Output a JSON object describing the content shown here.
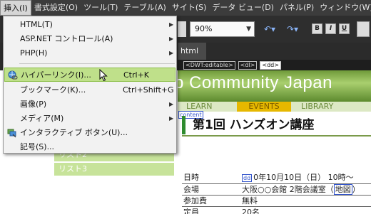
{
  "menubar": [
    {
      "label": "挿入(I)",
      "active": true
    },
    {
      "label": "書式設定(O)"
    },
    {
      "label": "ツール(T)"
    },
    {
      "label": "テーブル(A)"
    },
    {
      "label": "サイト(S)"
    },
    {
      "label": "データ ビュー(D)"
    },
    {
      "label": "パネル(P)"
    },
    {
      "label": "ウィンドウ(W)"
    }
  ],
  "toolbar": {
    "zoom": "90%",
    "bold": "B",
    "italic": "I",
    "underline": "U"
  },
  "tab": {
    "label": "html"
  },
  "tagbar": [
    "<DWT:editable>",
    "<dl>",
    "<dd>"
  ],
  "banner": {
    "title": "b Community Japan"
  },
  "nav": {
    "learn": "LEARN",
    "events": "EVENTS",
    "library": "LIBRARY"
  },
  "content_label": "content",
  "sidebar_list": [
    "リスト2",
    "リスト3"
  ],
  "heading": "第1回 ハンズオン講座",
  "info_table": {
    "dd_tag": "dd",
    "rows": [
      {
        "key": "日時",
        "value": "0年10月10日（日） 10時〜"
      },
      {
        "key": "会場",
        "value": "大阪○○会館 2階会議室（",
        "map": "地図",
        "tail": "）"
      },
      {
        "key": "参加費",
        "value": "無料"
      },
      {
        "key": "定員",
        "value": "20名"
      }
    ]
  },
  "insert_menu": {
    "items": [
      {
        "label": "HTML(T)",
        "submenu": true
      },
      {
        "label": "ASP.NET コントロール(A)",
        "submenu": true
      },
      {
        "label": "PHP(H)",
        "submenu": true
      },
      {
        "label": "ハイパーリンク(I)...",
        "shortcut": "Ctrl+K",
        "highlighted": true,
        "icon": "hyperlink-icon"
      },
      {
        "label": "ブックマーク(K)...",
        "shortcut": "Ctrl+Shift+G"
      },
      {
        "label": "画像(P)",
        "submenu": true
      },
      {
        "label": "メディア(M)",
        "submenu": true
      },
      {
        "label": "インタラクティブ ボタン(U)...",
        "icon": "interactive-button-icon"
      },
      {
        "label": "記号(S)..."
      }
    ]
  },
  "colors": {
    "menu_highlight": "#bfe08a",
    "banner_green": "#6f9a3a",
    "events_tab": "#e6b800",
    "list_green": "#c7e39a"
  }
}
